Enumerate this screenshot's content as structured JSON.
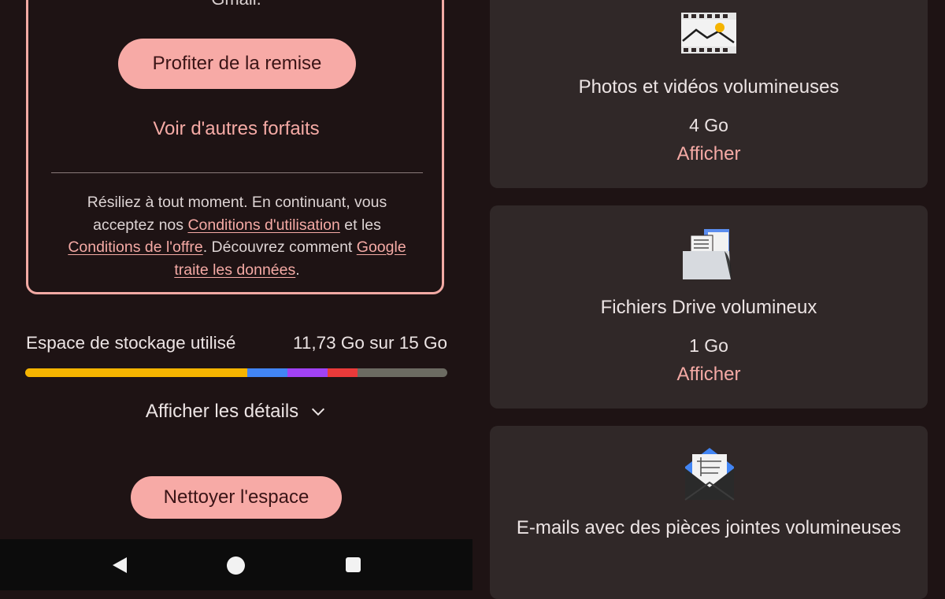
{
  "offer": {
    "top_text": "Gmail.",
    "discount_button": "Profiter de la remise",
    "other_plans_link": "Voir d'autres forfaits",
    "terms": {
      "text1": "Résiliez à tout moment. En continuant, vous acceptez nos ",
      "link_terms": "Conditions d'utilisation",
      "text2": " et les ",
      "link_offer": "Conditions de l'offre",
      "text3": ". Découvrez comment ",
      "link_privacy": "Google traite les données",
      "text4": "."
    }
  },
  "storage": {
    "label": "Espace de stockage utilisé",
    "value": "11,73 Go sur 15 Go",
    "segments": [
      {
        "color": "#f5b400",
        "fraction": 0.527
      },
      {
        "color": "#4285f4",
        "fraction": 0.095
      },
      {
        "color": "#a142f4",
        "fraction": 0.095
      },
      {
        "color": "#ea3a3a",
        "fraction": 0.07
      }
    ],
    "track_color": "#6c6b62",
    "details_label": "Afficher les détails",
    "clean_button": "Nettoyer l'espace"
  },
  "navbar": {
    "icons": [
      "back-icon",
      "home-icon",
      "recents-icon"
    ]
  },
  "cards": [
    {
      "title": "Photos et vidéos volumineuses",
      "size": "4 Go",
      "link": "Afficher",
      "icon": "photo-film-icon"
    },
    {
      "title": "Fichiers Drive volumineux",
      "size": "1 Go",
      "link": "Afficher",
      "icon": "drive-folder-icon"
    },
    {
      "title": "E-mails avec des pièces jointes volumineuses",
      "size": "",
      "link": "",
      "icon": "email-attachment-icon"
    }
  ],
  "colors": {
    "accent": "#f7aaa6",
    "link": "#f5aaa5",
    "background": "#1e1314",
    "card_background": "#302828"
  }
}
